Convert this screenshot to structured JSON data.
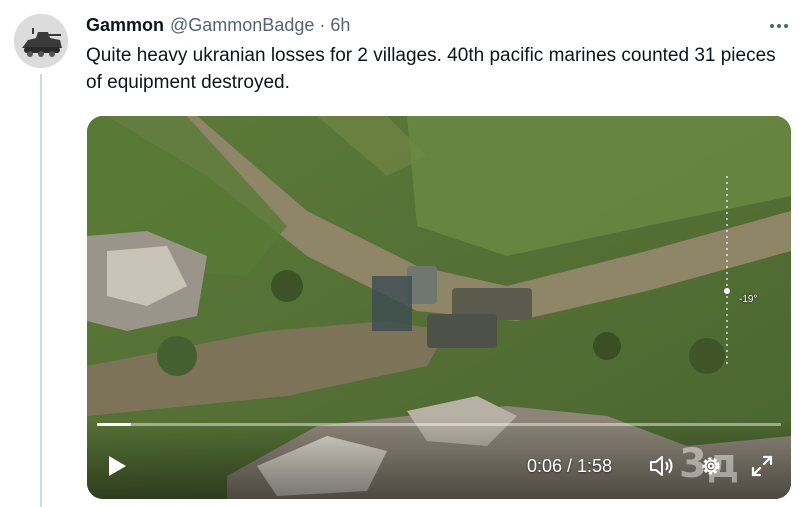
{
  "author": {
    "display_name": "Gammon",
    "handle": "@GammonBadge",
    "separator": "·",
    "time": "6h"
  },
  "tweet": {
    "text": "Quite heavy ukranian losses for 2 villages. 40th pacific marines counted 31 pieces of equipment destroyed."
  },
  "video": {
    "timecode": "0:06 / 1:58",
    "progress_fraction": 0.05,
    "overlay_scale_label": "-19°",
    "watermark": "3д"
  },
  "icons": {
    "more": "more-horizontal-icon",
    "play": "play-icon",
    "volume": "volume-icon",
    "settings": "gear-icon",
    "fullscreen": "fullscreen-icon"
  },
  "colors": {
    "text_primary": "#0f1419",
    "text_secondary": "#536471",
    "thread_line": "#cfd9de"
  }
}
